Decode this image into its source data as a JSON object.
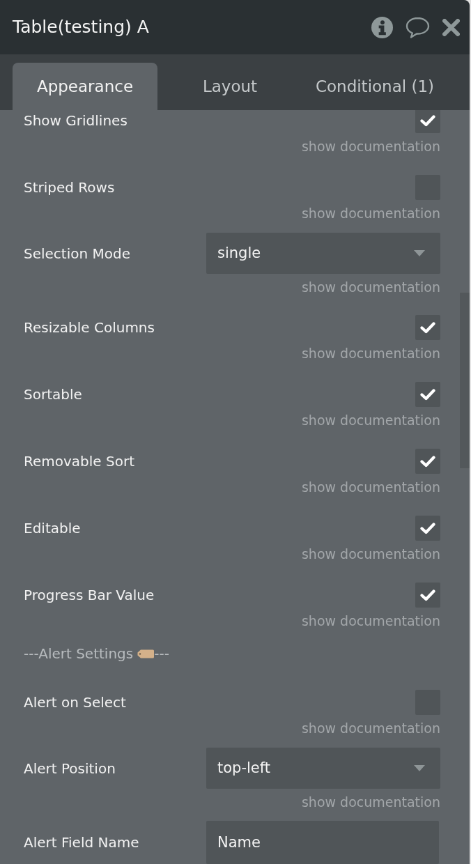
{
  "panel": {
    "title": "Table(testing) A"
  },
  "tabs": [
    {
      "label": "Appearance",
      "selected": true
    },
    {
      "label": "Layout",
      "selected": false
    },
    {
      "label": "Conditional (1)",
      "selected": false
    }
  ],
  "properties": [
    {
      "kind": "checkbox",
      "label": "Show Gridlines",
      "checked": true,
      "doc_link": "show documentation"
    },
    {
      "kind": "checkbox",
      "label": "Striped Rows",
      "checked": false,
      "doc_link": "show documentation"
    },
    {
      "kind": "dropdown",
      "label": "Selection Mode",
      "value": "single",
      "doc_link": "show documentation"
    },
    {
      "kind": "checkbox",
      "label": "Resizable Columns",
      "checked": true,
      "doc_link": "show documentation"
    },
    {
      "kind": "checkbox",
      "label": "Sortable",
      "checked": true,
      "doc_link": "show documentation"
    },
    {
      "kind": "checkbox",
      "label": "Removable Sort",
      "checked": true,
      "doc_link": "show documentation"
    },
    {
      "kind": "checkbox",
      "label": "Editable",
      "checked": true,
      "doc_link": "show documentation"
    },
    {
      "kind": "checkbox",
      "label": "Progress Bar Value",
      "checked": true,
      "doc_link": "show documentation"
    },
    {
      "kind": "section",
      "text": "---Alert Settings",
      "trailing": "---"
    },
    {
      "kind": "checkbox",
      "label": "Alert on Select",
      "checked": false,
      "doc_link": "show documentation"
    },
    {
      "kind": "dropdown",
      "label": "Alert Position",
      "value": "top-left",
      "doc_link": "show documentation"
    },
    {
      "kind": "input",
      "label": "Alert Field Name",
      "value": "Name"
    }
  ]
}
